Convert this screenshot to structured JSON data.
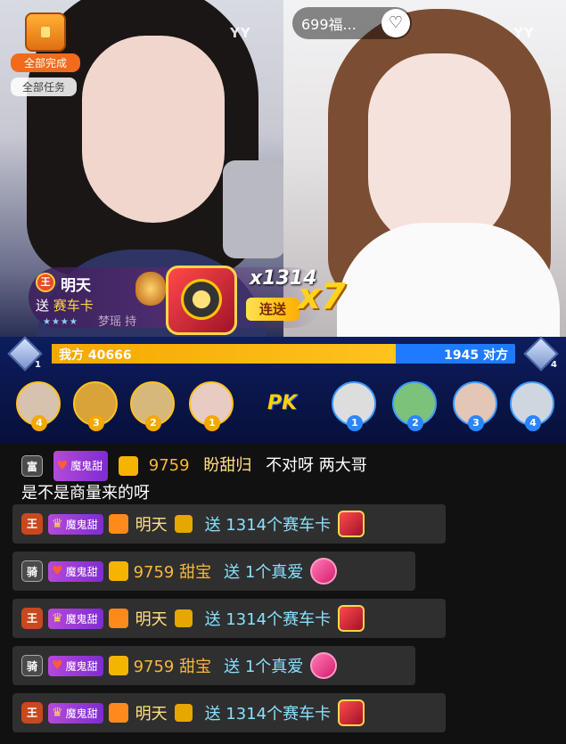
{
  "video": {
    "left_logo": "YY",
    "right_logo": "YY"
  },
  "task": {
    "done_label": "全部完成",
    "all_label": "全部任务"
  },
  "top_pill": {
    "text": "699福..."
  },
  "gift_banner": {
    "rank_badge": "王",
    "sender": "明天",
    "send_word": "送",
    "gift_name": "赛车卡",
    "count": "x1314",
    "combo_label": "连送",
    "multiplier": "x7",
    "ticker": "梦瑶 持"
  },
  "pk": {
    "left_label": "我方 40666",
    "right_label": "1945 对方",
    "left_score": 40666,
    "right_score": 1945,
    "left_rank": "1",
    "right_rank": "4",
    "center_label": "PK",
    "left_seats": [
      "4",
      "3",
      "2",
      "1"
    ],
    "right_seats": [
      "1",
      "2",
      "3",
      "4"
    ]
  },
  "chat": {
    "first_message": {
      "level": "富",
      "tag": "魔鬼甜",
      "num": "9759",
      "user": "盼甜归",
      "text_line1": "不对呀 两大哥",
      "text_line2": "是不是商量来的呀"
    },
    "messages": [
      {
        "level": "王",
        "tag": "魔鬼甜",
        "user": "明天",
        "action": "送 1314个赛车卡",
        "kind": "king"
      },
      {
        "level": "骑",
        "tag": "魔鬼甜",
        "user": "9759  甜宝",
        "action": "送 1个真爱",
        "kind": "knight"
      },
      {
        "level": "王",
        "tag": "魔鬼甜",
        "user": "明天",
        "action": "送 1314个赛车卡",
        "kind": "king"
      },
      {
        "level": "骑",
        "tag": "魔鬼甜",
        "user": "9759  甜宝",
        "action": "送 1个真爱",
        "kind": "knight"
      },
      {
        "level": "王",
        "tag": "魔鬼甜",
        "user": "明天",
        "action": "送 1314个赛车卡",
        "kind": "king"
      }
    ]
  }
}
